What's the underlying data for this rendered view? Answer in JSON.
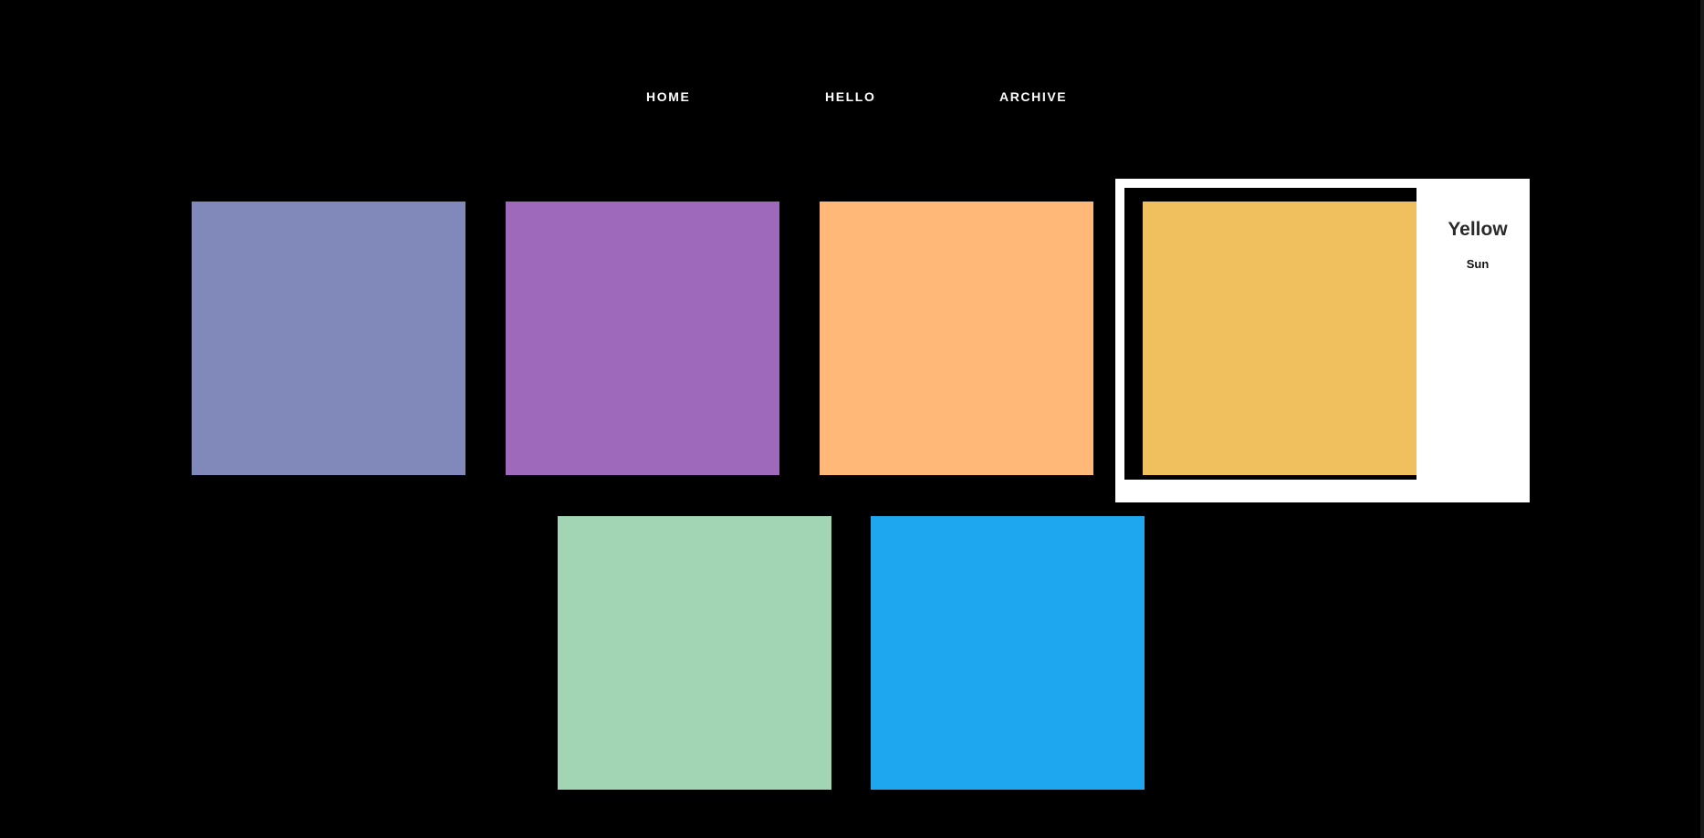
{
  "nav": {
    "items": [
      {
        "label": "HOME"
      },
      {
        "label": "HELLO"
      },
      {
        "label": "ARCHIVE"
      }
    ]
  },
  "colors": {
    "background": "#000000",
    "nav_text": "#ffffff",
    "card_background": "#ffffff"
  },
  "swatches": [
    {
      "color": "#8089ba"
    },
    {
      "color": "#9e69ba"
    },
    {
      "color": "#ffb877"
    },
    {
      "color": "#f0c05f",
      "name": "Yellow",
      "description": "Sun",
      "active": true
    },
    {
      "color": "#a2d5b3"
    },
    {
      "color": "#1ea7ee"
    }
  ]
}
